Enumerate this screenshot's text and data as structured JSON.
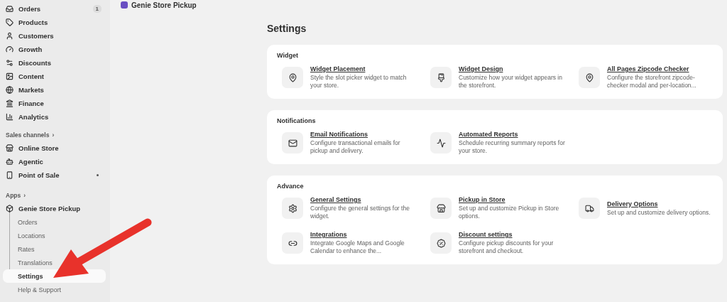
{
  "header": {
    "title": "Genie Store Pickup"
  },
  "sidebar": {
    "items": [
      {
        "label": "Orders",
        "badge": "1"
      },
      {
        "label": "Products"
      },
      {
        "label": "Customers"
      },
      {
        "label": "Growth"
      },
      {
        "label": "Discounts"
      },
      {
        "label": "Content"
      },
      {
        "label": "Markets"
      },
      {
        "label": "Finance"
      },
      {
        "label": "Analytics"
      }
    ],
    "sales_channels": {
      "label": "Sales channels",
      "chevron": "›",
      "items": [
        {
          "label": "Online Store",
          "pinned": false
        },
        {
          "label": "Agentic",
          "pinned": false
        },
        {
          "label": "Point of Sale",
          "pinned": true
        }
      ]
    },
    "apps": {
      "label": "Apps",
      "chevron": "›",
      "app": {
        "label": "Genie Store Pickup",
        "children": [
          {
            "label": "Orders",
            "selected": false
          },
          {
            "label": "Locations",
            "selected": false
          },
          {
            "label": "Rates",
            "selected": false
          },
          {
            "label": "Translations",
            "selected": false
          },
          {
            "label": "Settings",
            "selected": true
          },
          {
            "label": "Help & Support",
            "selected": false
          }
        ]
      }
    }
  },
  "page": {
    "title": "Settings",
    "cards": [
      {
        "title": "Widget",
        "items": [
          {
            "title": "Widget Placement",
            "description": "Style the slot picker widget to match your store."
          },
          {
            "title": "Widget Design",
            "description": "Customize how your widget appears in the storefront."
          },
          {
            "title": "All Pages Zipcode Checker",
            "description": "Configure the storefront zipcode-checker modal and per-location..."
          }
        ]
      },
      {
        "title": "Notifications",
        "items": [
          {
            "title": "Email Notifications",
            "description": "Configure transactional emails for pickup and delivery."
          },
          {
            "title": "Automated Reports",
            "description": "Schedule recurring summary reports for your store."
          }
        ]
      },
      {
        "title": "Advance",
        "items": [
          {
            "title": "General Settings",
            "description": "Configure the general settings for the widget."
          },
          {
            "title": "Pickup in Store",
            "description": "Set up and customize Pickup in Store options."
          },
          {
            "title": "Delivery Options",
            "description": "Set up and customize delivery options."
          },
          {
            "title": "Integrations",
            "description": "Integrate Google Maps and Google Calendar to enhance the..."
          },
          {
            "title": "Discount settings",
            "description": "Configure pickup discounts for your storefront and checkout."
          }
        ]
      }
    ]
  }
}
